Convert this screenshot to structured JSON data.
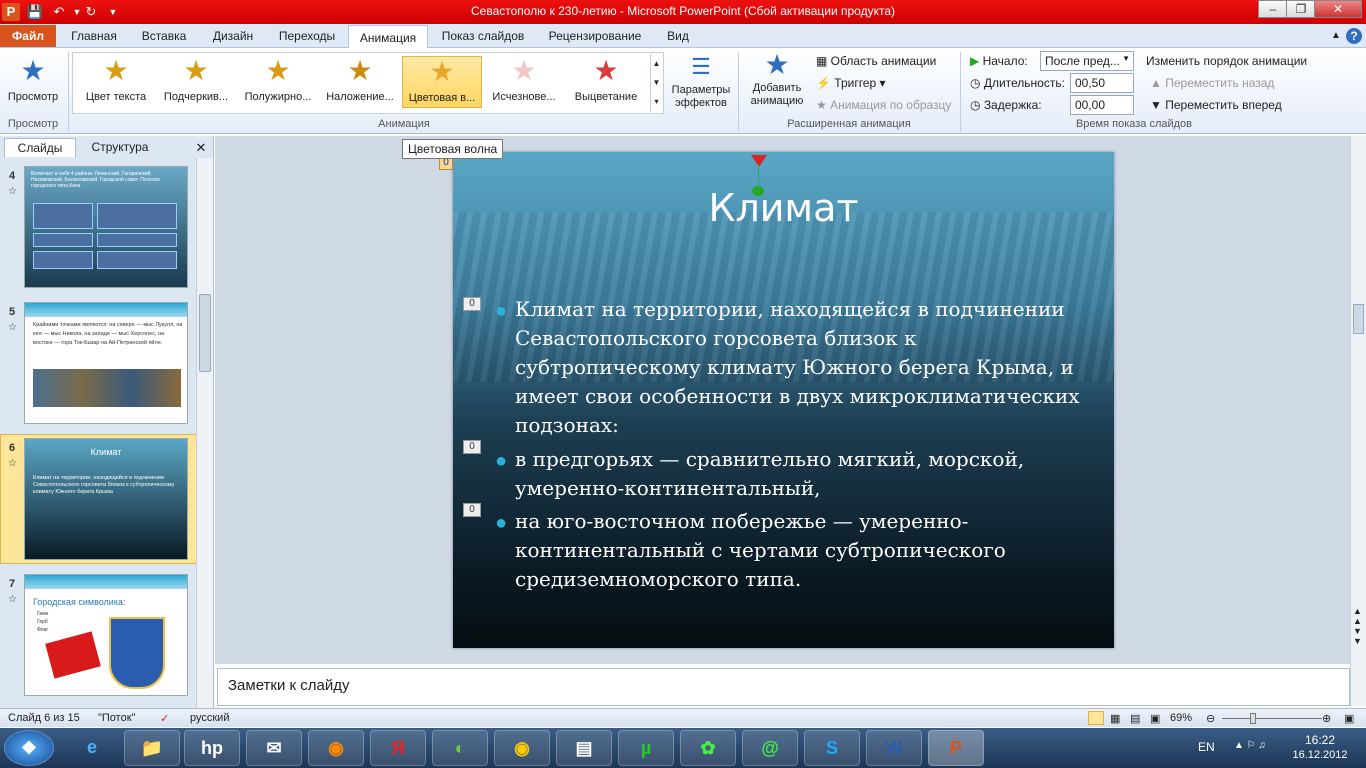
{
  "window": {
    "title": "Севастополю к 230-летию  -  Microsoft PowerPoint (Сбой активации продукта)"
  },
  "tabs": [
    "Файл",
    "Главная",
    "Вставка",
    "Дизайн",
    "Переходы",
    "Анимация",
    "Показ слайдов",
    "Рецензирование",
    "Вид"
  ],
  "ribbon": {
    "preview_label": "Просмотр",
    "preview_group": "Просмотр",
    "animations": [
      {
        "label": "Цвет текста",
        "glyph": "А",
        "color": "#d99b12"
      },
      {
        "label": "Подчеркив...",
        "glyph": "Ч",
        "color": "#d99b12"
      },
      {
        "label": "Полужирно...",
        "glyph": "Ж",
        "color": "#d99b12"
      },
      {
        "label": "Наложение...",
        "glyph": "Ж",
        "color": "#d99b12"
      },
      {
        "label": "Цветовая в...",
        "glyph": "",
        "color": "#e8a72b"
      },
      {
        "label": "Исчезнове...",
        "glyph": "",
        "color": "#f1c6c6"
      },
      {
        "label": "Выцветание",
        "glyph": "",
        "color": "#d93b3b"
      }
    ],
    "effect_params": "Параметры эффектов",
    "animation_group": "Анимация",
    "add_animation": "Добавить анимацию",
    "anim_pane": "Область анимации",
    "trigger": "Триггер",
    "anim_painter": "Анимация по образцу",
    "advanced_group": "Расширенная анимация",
    "start_label": "Начало:",
    "start_value": "После пред...",
    "duration_label": "Длительность:",
    "duration_value": "00,50",
    "delay_label": "Задержка:",
    "delay_value": "00,00",
    "reorder_label": "Изменить порядок анимации",
    "move_earlier": "Переместить назад",
    "move_later": "Переместить вперед",
    "timing_group": "Время показа слайдов"
  },
  "left_tabs": [
    "Слайды",
    "Структура"
  ],
  "thumbnails": [
    {
      "num": "4",
      "text": "Включает в себя 4 района: Ленинский, Гагаринский, Нахимовский, Балаклавский. Городской совет. Поселок городского типа Кача"
    },
    {
      "num": "5",
      "text": "Крайними точками являются: на севере — мыс Лукулл, на юге — мыс Никола, на западе — мыс Херсонес, на востоке — гора Ток-Базар на Ай-Петринской яйле."
    },
    {
      "num": "6",
      "title": "Климат",
      "text": "Климат на территории, находящейся в подчинении Севастопольского горсовета близок к субтропическому климату Южного берега Крыма"
    },
    {
      "num": "7",
      "title": "Городская символика:",
      "items": [
        "Гимн",
        "Герб",
        "Флаг"
      ]
    }
  ],
  "tooltip": "Цветовая волна",
  "slide": {
    "title": "Климат",
    "tags": [
      "0",
      "0",
      "0",
      "0"
    ],
    "bullets": [
      "Климат на территории, находящейся в подчинении Севастопольского горсовета близок к субтропическому климату Южного берега Крыма, и имеет свои особенности в двух микроклиматических подзонах:",
      "в предгорьях — сравнительно мягкий, морской, умеренно-континентальный,",
      "на юго-восточном побережье — умеренно-континентальный с чертами субтропического средиземноморского типа."
    ]
  },
  "notes_placeholder": "Заметки к слайду",
  "status": {
    "slide": "Слайд 6 из 15",
    "theme": "\"Поток\"",
    "lang": "русский",
    "zoom": "69%"
  },
  "taskbar": {
    "lang": "EN",
    "time": "16:22",
    "date": "16.12.2012"
  }
}
